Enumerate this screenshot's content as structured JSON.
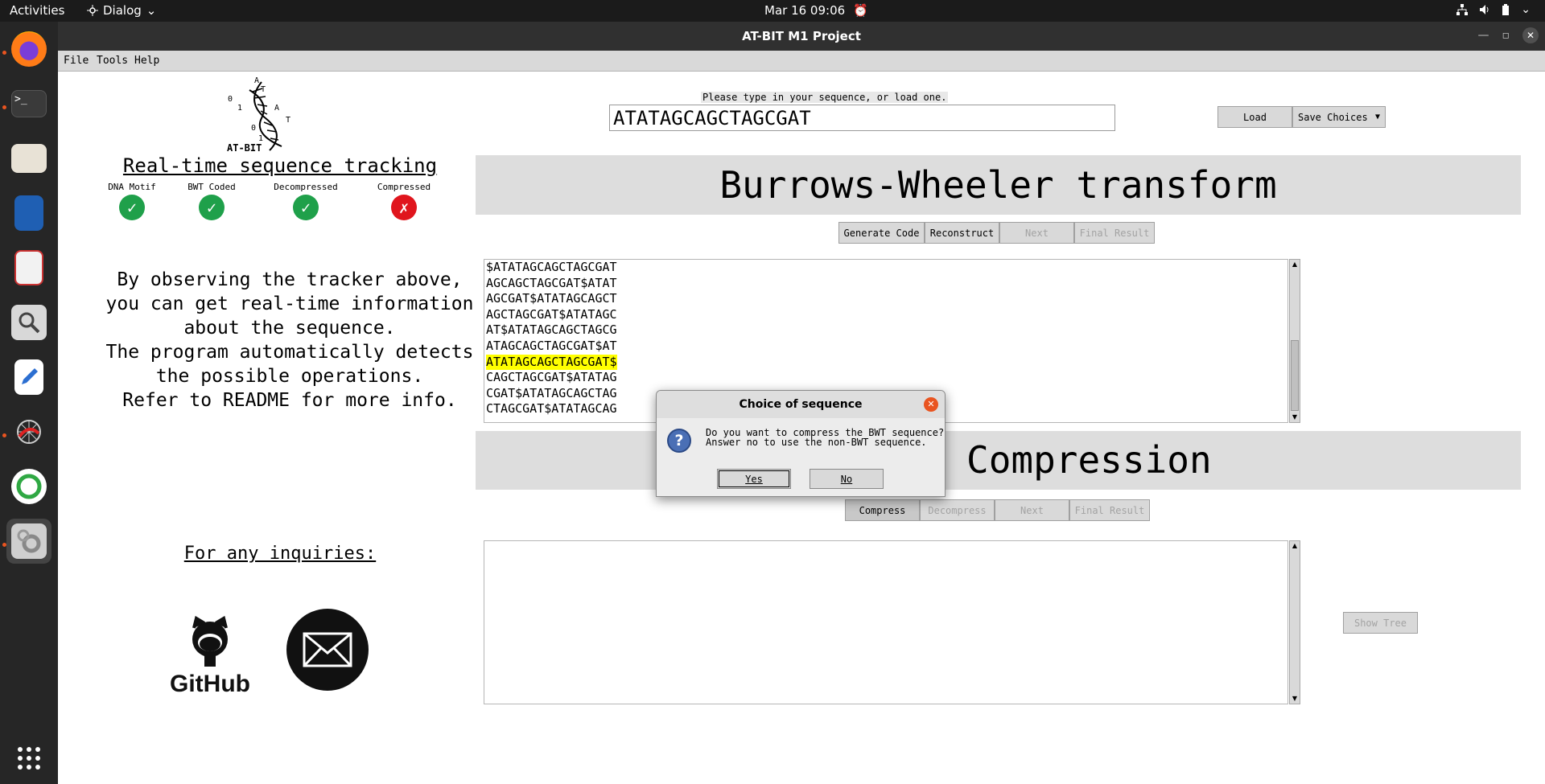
{
  "topbar": {
    "activities": "Activities",
    "app_menu": "Dialog",
    "datetime": "Mar 16  09:06"
  },
  "dock": {
    "items": [
      "firefox-icon",
      "terminal-icon",
      "files-icon",
      "writer-icon",
      "document-viewer-icon",
      "search-icon",
      "text-editor-icon",
      "spider-icon",
      "green-ring-icon",
      "settings-app-icon",
      "app-grid-icon"
    ]
  },
  "window": {
    "title": "AT-BIT M1 Project",
    "menu": [
      "File",
      "Tools",
      "Help"
    ]
  },
  "left_panel": {
    "logo_text": "AT-BIT",
    "logo_letters": [
      "A",
      "T",
      "0",
      "1",
      "A",
      "0",
      "T",
      "1"
    ],
    "tracker_title": "Real-time sequence tracking",
    "tracker": [
      {
        "label": "DNA Motif",
        "status": "✓"
      },
      {
        "label": "BWT Coded",
        "status": "✓"
      },
      {
        "label": "Decompressed",
        "status": "✓"
      },
      {
        "label": "Compressed",
        "status": "✗"
      }
    ],
    "info_lines": [
      "By observing the tracker above,",
      "you can get real-time information",
      "about the sequence.",
      "The program automatically detects",
      "the possible operations.",
      "Refer to README for more info."
    ],
    "inquiries": "For any inquiries:",
    "github_label": "GitHub"
  },
  "input": {
    "prompt": "Please type in your sequence, or load one.",
    "sequence": "ATATAGCAGCTAGCGAT",
    "load_label": "Load",
    "save_label": "Save Choices"
  },
  "bwt": {
    "title": "Burrows-Wheeler transform",
    "buttons": [
      "Generate Code",
      "Reconstruct",
      "Next",
      "Final Result"
    ],
    "rows": [
      "$ATATAGCAGCTAGCGAT",
      "AGCAGCTAGCGAT$ATAT",
      "AGCGAT$ATATAGCAGCT",
      "AGCTAGCGAT$ATATAGC",
      "AT$ATATAGCAGCTAGCG",
      "ATAGCAGCTAGCGAT$AT",
      "ATATAGCAGCTAGCGAT$",
      "CAGCTAGCGAT$ATATAG",
      "CGAT$ATATAGCAGCTAG",
      "CTAGCGAT$ATATAGCAG"
    ],
    "highlight_color": "#ffff00"
  },
  "compression": {
    "title": "Compression",
    "buttons": [
      "Compress",
      "Decompress",
      "Next",
      "Final Result"
    ],
    "show_tree": "Show Tree"
  },
  "dialog": {
    "title": "Choice of sequence",
    "message_line1": "Do you want to compress the BWT sequence?",
    "message_line2": "Answer no to use the non-BWT sequence.",
    "yes": "Yes",
    "no": "No"
  },
  "colors": {
    "ok": "#1fa04a",
    "error": "#e0151d",
    "accent": "#e95420"
  }
}
